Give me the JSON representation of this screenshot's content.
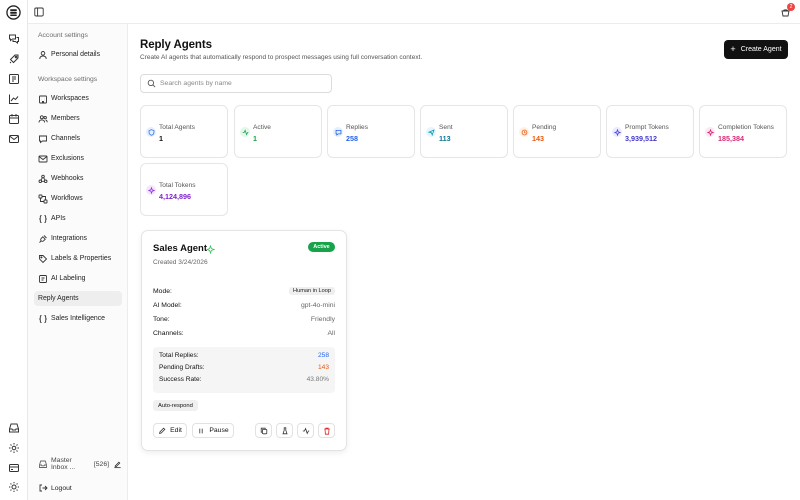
{
  "sidebar": {
    "account_section": "Account settings",
    "workspace_section": "Workspace settings",
    "items": [
      {
        "label": "Personal details",
        "icon": "user-icon"
      },
      {
        "label": "Workspaces",
        "icon": "building-icon"
      },
      {
        "label": "Members",
        "icon": "users-icon"
      },
      {
        "label": "Channels",
        "icon": "chat-icon"
      },
      {
        "label": "Exclusions",
        "icon": "mail-x-icon"
      },
      {
        "label": "Webhooks",
        "icon": "webhook-icon"
      },
      {
        "label": "Workflows",
        "icon": "workflow-icon"
      },
      {
        "label": "APIs",
        "icon": "braces-icon"
      },
      {
        "label": "Integrations",
        "icon": "plug-icon"
      },
      {
        "label": "Labels & Properties",
        "icon": "tag-icon"
      },
      {
        "label": "AI Labeling",
        "icon": "ai-tag-icon"
      },
      {
        "label": "Reply Agents",
        "icon": "none"
      },
      {
        "label": "Sales Intelligence",
        "icon": "braces-icon"
      }
    ],
    "inbox_name": "Master Inbox ...",
    "inbox_count": "[526]",
    "logout": "Logout"
  },
  "topbar": {
    "notification_count": "2"
  },
  "page": {
    "title": "Reply Agents",
    "subtitle": "Create AI agents that automatically respond to prospect messages using full conversation context.",
    "create_button": "Create Agent",
    "search_placeholder": "Search agents by name"
  },
  "stats": [
    {
      "label": "Total Agents",
      "value": "1",
      "color": "#111111",
      "icon": "shield-icon",
      "icon_color": "#2f6fe4",
      "icon_bg": "#e6efff"
    },
    {
      "label": "Active",
      "value": "1",
      "color": "#16a34a",
      "icon": "activity-icon",
      "icon_color": "#16a34a",
      "icon_bg": "#e3f7ea"
    },
    {
      "label": "Replies",
      "value": "258",
      "color": "#2563eb",
      "icon": "message-icon",
      "icon_color": "#2563eb",
      "icon_bg": "#e6efff"
    },
    {
      "label": "Sent",
      "value": "113",
      "color": "#0e7490",
      "icon": "send-icon",
      "icon_color": "#0891b2",
      "icon_bg": "#e2f6fb"
    },
    {
      "label": "Pending",
      "value": "143",
      "color": "#ea580c",
      "icon": "clock-icon",
      "icon_color": "#ea580c",
      "icon_bg": "#fff0e3"
    },
    {
      "label": "Prompt Tokens",
      "value": "3,939,512",
      "color": "#4338ca",
      "icon": "sparkle-icon",
      "icon_color": "#4f46e5",
      "icon_bg": "#ebeafe"
    },
    {
      "label": "Completion Tokens",
      "value": "185,384",
      "color": "#db2777",
      "icon": "sparkle-icon",
      "icon_color": "#db2777",
      "icon_bg": "#fde7f1"
    },
    {
      "label": "Total Tokens",
      "value": "4,124,896",
      "color": "#7e22ce",
      "icon": "sparkle-icon",
      "icon_color": "#9333ea",
      "icon_bg": "#f3e6fd"
    }
  ],
  "agent": {
    "name": "Sales Agent",
    "created": "Created 3/24/2026",
    "status": "Active",
    "mode_label": "Mode:",
    "mode_value": "Human in Loop",
    "model_label": "AI Model:",
    "model_value": "gpt-4o-mini",
    "tone_label": "Tone:",
    "tone_value": "Friendly",
    "channels_label": "Channels:",
    "channels_value": "All",
    "total_replies_label": "Total Replies:",
    "total_replies": "258",
    "pending_label": "Pending Drafts:",
    "pending": "143",
    "success_label": "Success Rate:",
    "success": "43.80%",
    "tag": "Auto-respond",
    "edit": "Edit",
    "pause": "Pause"
  },
  "colors": {
    "accent": "#111111",
    "active": "#16a34a",
    "delete": "#dc2626"
  }
}
